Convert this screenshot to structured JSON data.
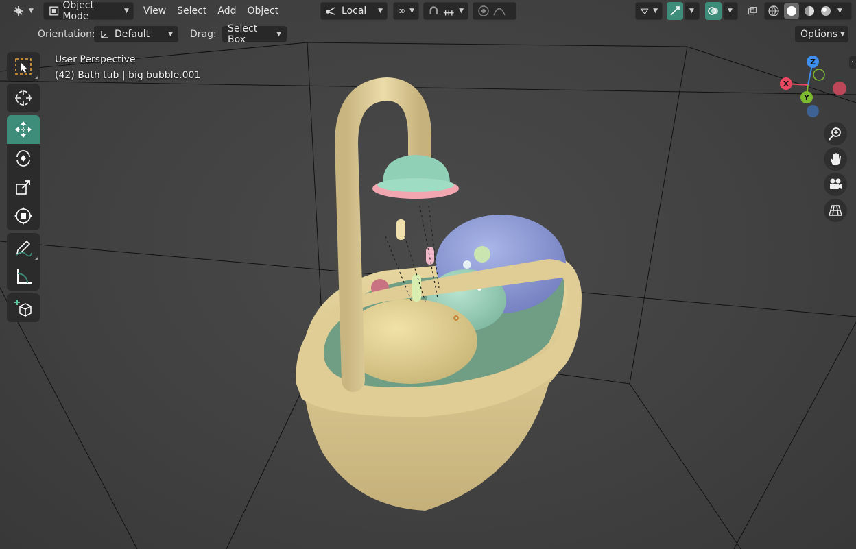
{
  "header": {
    "mode_label": "Object Mode",
    "menus": [
      "View",
      "Select",
      "Add",
      "Object"
    ],
    "transform_orientation": "Local"
  },
  "tool_settings": {
    "orientation_label": "Orientation:",
    "orientation_value": "Default",
    "drag_label": "Drag:",
    "drag_value": "Select Box",
    "options_label": "Options"
  },
  "viewport": {
    "perspective_label": "User Perspective",
    "object_info": "(42) Bath tub | big bubble.001"
  },
  "gizmo": {
    "x_label": "X",
    "y_label": "Y",
    "z_label": "Z",
    "colors": {
      "x": "#e84860",
      "y": "#7dbb30",
      "z": "#3d8ff0"
    }
  },
  "toolbar": {
    "tools": [
      "select-box",
      "cursor",
      "move",
      "rotate",
      "scale",
      "transform",
      "annotate",
      "measure",
      "add-cube"
    ],
    "active_tool": "move"
  },
  "colors": {
    "accent": "#3e8d7a",
    "header_bg": "#3d3d3d",
    "widget_bg": "#282828"
  }
}
